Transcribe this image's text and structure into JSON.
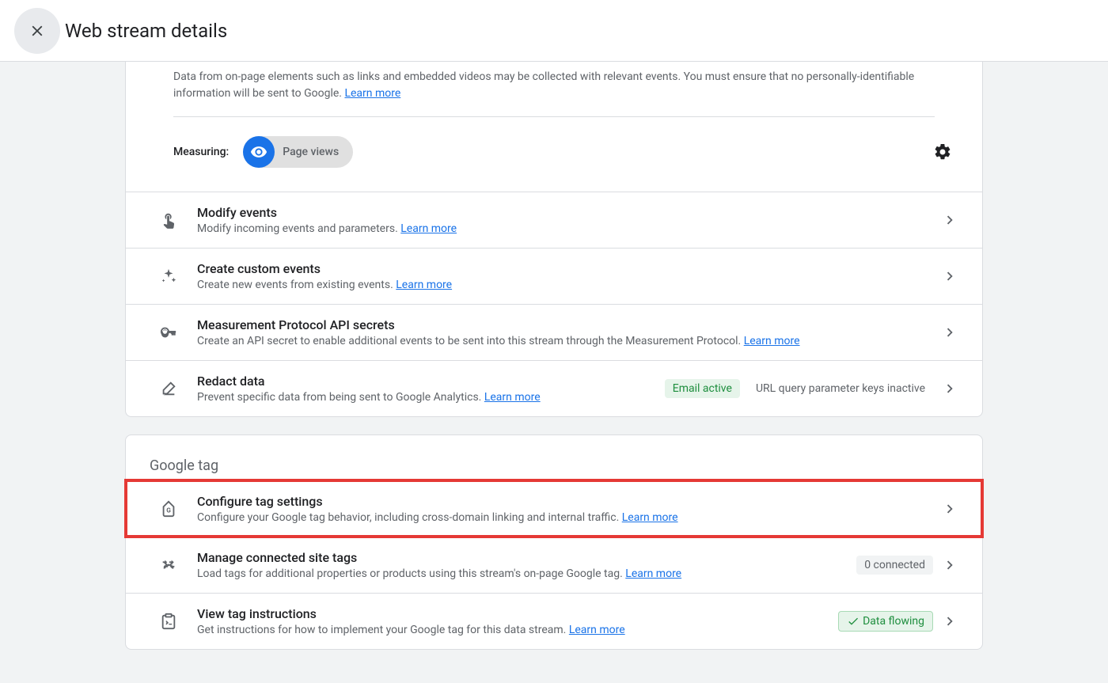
{
  "header": {
    "title": "Web stream details"
  },
  "enhanced": {
    "desc_prefix": "Data from on-page elements such as links and embedded videos may be collected with relevant events. You must ensure that no personally-identifiable information will be sent to Google. ",
    "learn_more": "Learn more",
    "measuring_label": "Measuring:",
    "pill_label": "Page views"
  },
  "events": [
    {
      "icon": "touch-icon",
      "title": "Modify events",
      "sub_prefix": "Modify incoming events and parameters. ",
      "learn_more": "Learn more"
    },
    {
      "icon": "sparkle-icon",
      "title": "Create custom events",
      "sub_prefix": "Create new events from existing events. ",
      "learn_more": "Learn more"
    },
    {
      "icon": "key-icon",
      "title": "Measurement Protocol API secrets",
      "sub_prefix": "Create an API secret to enable additional events to be sent into this stream through the Measurement Protocol. ",
      "learn_more": "Learn more"
    },
    {
      "icon": "eraser-icon",
      "title": "Redact data",
      "sub_prefix": "Prevent specific data from being sent to Google Analytics. ",
      "learn_more": "Learn more",
      "badges": [
        {
          "label": "Email active",
          "cls": "badge-green"
        },
        {
          "label": "URL query parameter keys inactive",
          "cls": "badge-plain"
        }
      ]
    }
  ],
  "tag_section": {
    "header": "Google tag",
    "rows": [
      {
        "icon": "tag-icon",
        "title": "Configure tag settings",
        "sub_prefix": "Configure your Google tag behavior, including cross-domain linking and internal traffic. ",
        "learn_more": "Learn more",
        "highlight": true
      },
      {
        "icon": "connect-icon",
        "title": "Manage connected site tags",
        "sub_prefix": "Load tags for additional properties or products using this stream's on-page Google tag. ",
        "learn_more": "Learn more",
        "badges": [
          {
            "label": "0 connected",
            "cls": "badge-gray"
          }
        ]
      },
      {
        "icon": "clipboard-icon",
        "title": "View tag instructions",
        "sub_prefix": "Get instructions for how to implement your Google tag for this data stream. ",
        "learn_more": "Learn more",
        "badges": [
          {
            "label": "Data flowing",
            "cls": "badge-flowing",
            "check": true
          }
        ]
      }
    ]
  }
}
